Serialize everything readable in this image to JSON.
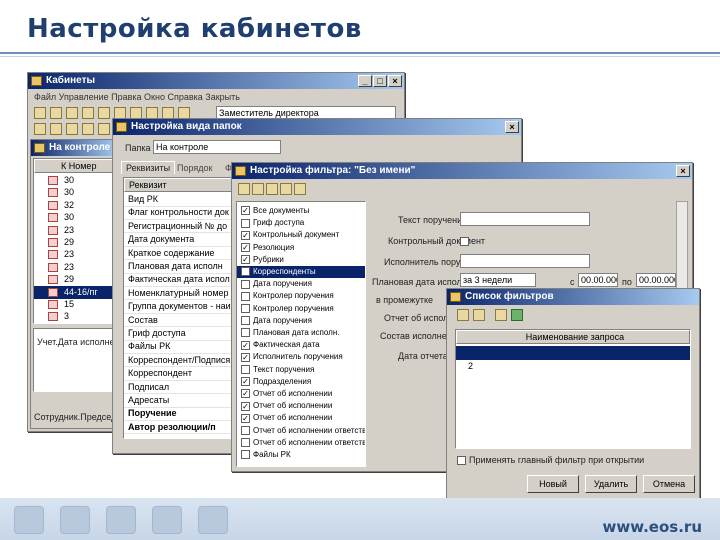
{
  "slide": {
    "title": "Настройка кабинетов",
    "footer_url": "www.eos.ru"
  },
  "win_cabinets": {
    "title": "Кабинеты",
    "menu": "Файл  Управление  Правка  Окно  Справка  Закрыть",
    "combo": "Заместитель директора",
    "subwin_title": "На контроле",
    "col_header": "К  Номер",
    "rows": [
      "30",
      "30",
      "32",
      "30",
      "23",
      "29",
      "23",
      "23",
      "29",
      "44-16/пг",
      "15",
      "3"
    ],
    "bottom_text": "Учет.Дата исполнения",
    "status": "Сотрудник.Председатель"
  },
  "win_view": {
    "title": "Настройка вида папок",
    "folder_label": "Папка",
    "folder_value": "На контроле",
    "tabs": [
      "Реквизиты",
      "Порядок",
      "Ф"
    ],
    "list_header": "Реквизит",
    "items": [
      "Вид РК",
      "Флаг контрольности док",
      "Регистрационный № до",
      "Дата документа",
      "Краткое содержание",
      "Плановая дата исполн",
      "Фактическая дата испол",
      "Номенклатурный номер д",
      "Группа документов - наи",
      "Состав",
      "Гриф доступа",
      "Файлы РК",
      "Корреспондент/Подпися",
      "Корреспондент",
      "Подписал",
      "Адресаты",
      "Поручение",
      "Автор резолюции/п"
    ]
  },
  "win_filter": {
    "title": "Настройка фильтра: \"Без имени\"",
    "checklist": [
      "Все документы",
      "Гриф доступа",
      "Контрольный документ",
      "Резолюция",
      "Рубрики",
      "Корреспонденты",
      "Дата поручения",
      "Контролер поручения",
      "Контролер поручения",
      "Дата поручения",
      "Плановая дата исполн.",
      "Фактическая дата",
      "Исполнитель поручения",
      "Текст поручения",
      "Подразделения",
      "Отчет об исполнении",
      "Отчет об исполнении",
      "Отчет об исполнении",
      "Отчет об исполнении ответственного",
      "Отчет об исполнении ответственного",
      "Файлы РК"
    ],
    "checked": [
      1,
      0,
      1,
      1,
      1,
      1,
      0,
      0,
      0,
      0,
      0,
      1,
      1,
      0,
      1,
      1,
      1,
      1,
      0,
      0,
      0
    ],
    "labels": [
      "Текст поручения",
      "Контрольный документ",
      "Исполнитель поручения",
      "Плановая дата исполнения",
      "в промежутке",
      "Отчет об исполнении",
      "Состав исполнения",
      "Дата отчета"
    ],
    "period_value": "за 3 недели",
    "from_label": "с",
    "to_label": "по",
    "date_from": "00.00.0000",
    "date_to": "00.00.0000"
  },
  "win_list": {
    "title": "Список фильтров",
    "header": "Наименование запроса",
    "rows": [
      "",
      "2"
    ],
    "apply_label": "Применять главный фильтр при открытии",
    "buttons": [
      "Новый",
      "Удалить",
      "Отмена"
    ]
  }
}
